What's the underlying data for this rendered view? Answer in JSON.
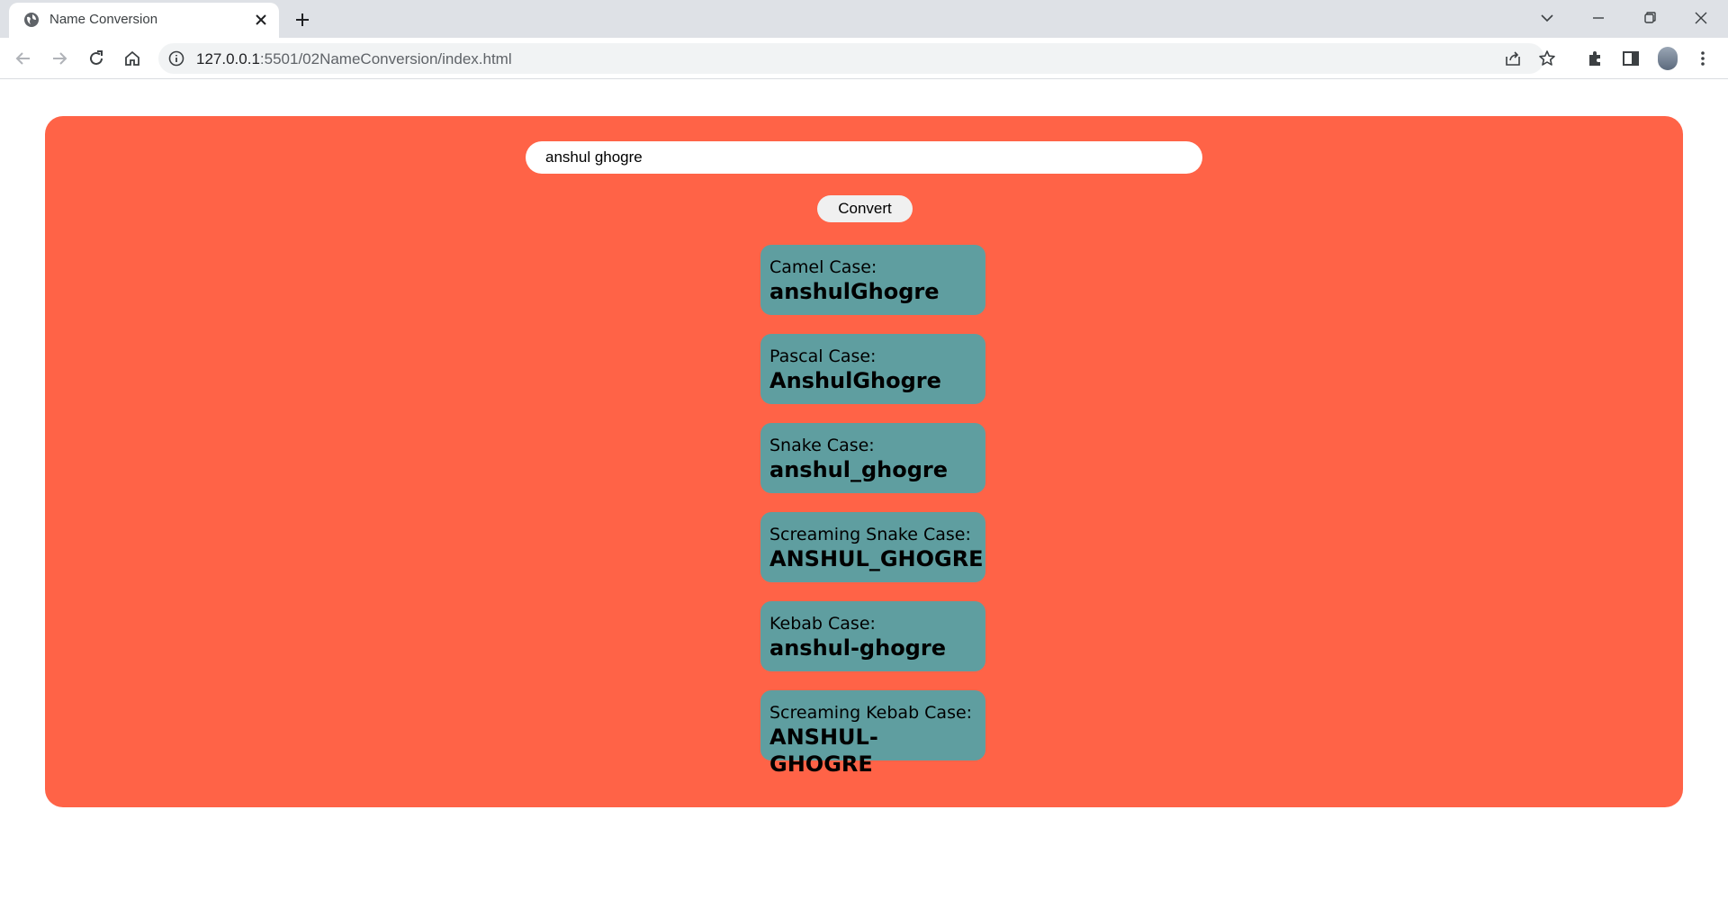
{
  "browser": {
    "tab_title": "Name Conversion",
    "url_host": "127.0.0.1",
    "url_path": ":5501/02NameConversion/index.html"
  },
  "form": {
    "input_value": "anshul ghogre",
    "convert_label": "Convert"
  },
  "results": [
    {
      "label": "Camel Case:",
      "value": "anshulGhogre"
    },
    {
      "label": "Pascal Case:",
      "value": "AnshulGhogre"
    },
    {
      "label": "Snake Case:",
      "value": "anshul_ghogre"
    },
    {
      "label": "Screaming Snake Case:",
      "value": "ANSHUL_GHOGRE"
    },
    {
      "label": "Kebab Case:",
      "value": "anshul-ghogre"
    },
    {
      "label": "Screaming Kebab Case:",
      "value": "ANSHUL-GHOGRE"
    }
  ],
  "colors": {
    "panel": "#ff6347",
    "card": "#5f9ea0",
    "tabstrip": "#dee1e6"
  }
}
